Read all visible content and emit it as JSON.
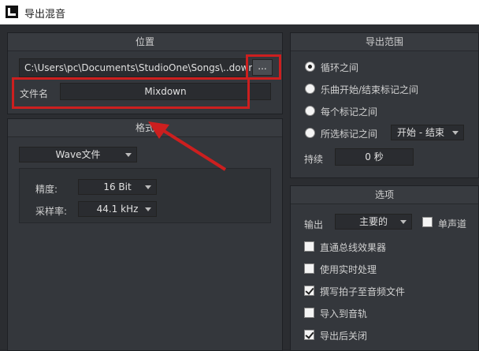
{
  "window": {
    "title": "导出混音"
  },
  "location": {
    "header": "位置",
    "path_value": "C:\\Users\\pc\\Documents\\StudioOne\\Songs\\..down",
    "browse_label": "...",
    "filename_label": "文件名",
    "filename_value": "Mixdown"
  },
  "format": {
    "header": "格式",
    "type_value": "Wave文件",
    "precision_label": "精度:",
    "precision_value": "16 Bit",
    "samplerate_label": "采样率:",
    "samplerate_value": "44.1 kHz"
  },
  "range": {
    "header": "导出范围",
    "options": [
      {
        "label": "循环之间",
        "selected": true
      },
      {
        "label": "乐曲开始/结束标记之间",
        "selected": false
      },
      {
        "label": "每个标记之间",
        "selected": false
      },
      {
        "label": "所选标记之间",
        "selected": false
      }
    ],
    "marker_select_value": "开始 - 结束",
    "duration_label": "持续",
    "duration_value": "0 秒"
  },
  "options": {
    "header": "选项",
    "output_label": "输出",
    "output_value": "主要的",
    "mono_label": "单声道",
    "mono_checked": false,
    "checks": [
      {
        "label": "直通总线效果器",
        "checked": false
      },
      {
        "label": "使用实时处理",
        "checked": false
      },
      {
        "label": "撰写拍子至音频文件",
        "checked": true
      },
      {
        "label": "导入到音轨",
        "checked": false
      },
      {
        "label": "导出后关闭",
        "checked": true
      }
    ]
  },
  "annotation": {
    "color": "#cc1f1f"
  }
}
